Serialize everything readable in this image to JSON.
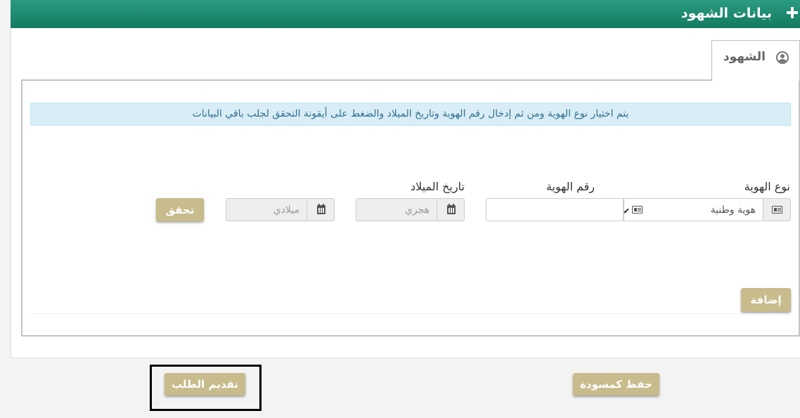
{
  "header": {
    "title": "بيانات الشهود",
    "icon": "plus-icon"
  },
  "tab": {
    "label": "الشهود",
    "icon": "user-circle-icon"
  },
  "info_message": "يتم اختيار نوع الهوية ومن ثم إدخال رقم الهوية وتاريخ الميلاد والضغط على أيقونة التحقق لجلب باقي البيانات",
  "form": {
    "id_type": {
      "label": "نوع الهوية",
      "value": "هوية وطنية",
      "icon": "id-card-icon"
    },
    "id_number": {
      "label": "رقم الهوية",
      "value": "",
      "icon": "id-card-icon"
    },
    "birth_date": {
      "label": "تاريخ الميلاد",
      "hijri_placeholder": "هجري",
      "gregorian_placeholder": "ميلادي",
      "icon": "calendar-icon"
    },
    "verify_label": "تحقق",
    "add_label": "إضافة"
  },
  "footer": {
    "save_draft_label": "حفظ كمسودة",
    "submit_label": "تقديم الطلب"
  },
  "colors": {
    "header_top": "#2a9b82",
    "header_bottom": "#137a60",
    "button": "#c8bb8c",
    "info_bg": "#d9edf7",
    "info_text": "#31708f"
  }
}
